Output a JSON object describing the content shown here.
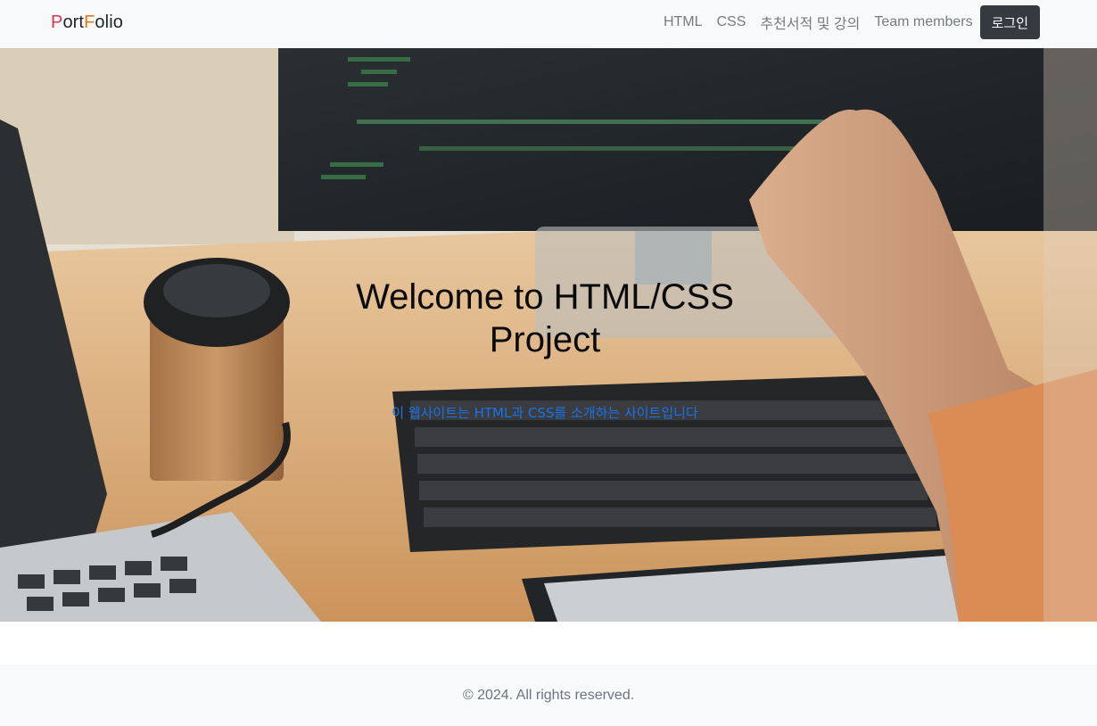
{
  "navbar": {
    "brand": {
      "p": "P",
      "ort": "ort",
      "f": "F",
      "olio": "olio"
    },
    "links": [
      "HTML",
      "CSS",
      "추천서적 및 강의",
      "Team members"
    ],
    "login_label": "로그인"
  },
  "hero": {
    "title": "Welcome to HTML/CSS Project",
    "subtitle": "이 웹사이트는 HTML과 CSS를 소개하는 사이트입니다"
  },
  "footer": {
    "text": "© 2024. All rights reserved."
  },
  "colors": {
    "navbar_bg": "#f8f9fa",
    "brand_accent": "#dc3545",
    "login_bg": "#343a40",
    "subtitle": "#1a73e8",
    "footer_text": "#6c757d"
  }
}
